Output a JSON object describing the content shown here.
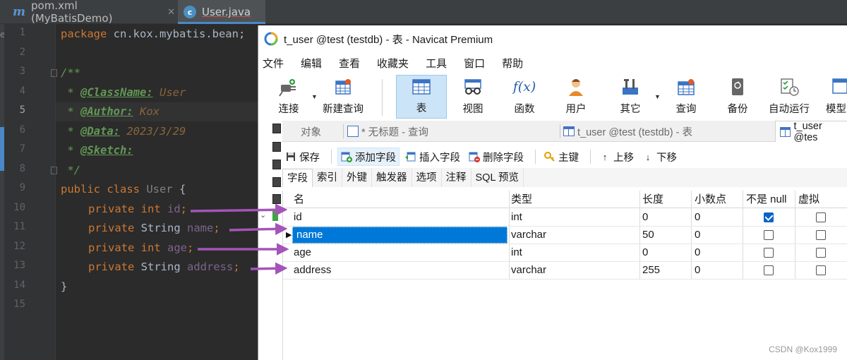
{
  "ide": {
    "tabs": [
      {
        "label": "pom.xml (MyBatisDemo)",
        "icon": "maven-m-icon"
      },
      {
        "label": "User.java",
        "icon": "java-class-icon"
      }
    ],
    "line_numbers": [
      "1",
      "2",
      "3",
      "4",
      "5",
      "6",
      "7",
      "8",
      "9",
      "10",
      "11",
      "12",
      "13",
      "14",
      "15"
    ],
    "current_line": "5",
    "code": {
      "l1_kw": "package",
      "l1_rest": " cn.kox.mybatis.bean;",
      "l3": "/**",
      "l4_pre": " * ",
      "l4_tag": "@ClassName:",
      "l4_val": " User",
      "l5_pre": " * ",
      "l5_tag": "@Author:",
      "l5_val": " Kox",
      "l6_pre": " * ",
      "l6_tag": "@Data:",
      "l6_val": " 2023/3/29",
      "l7_pre": " * ",
      "l7_tag": "@Sketch:",
      "l8": " */",
      "l9_kw": "public class",
      "l9_cls": " User",
      "l9_rest": " {",
      "l10_kw": "private int",
      "l10_fld": " id",
      "l10_end": ";",
      "l11_kw": "private",
      "l11_type": " String",
      "l11_fld": " name",
      "l11_end": ";",
      "l12_kw": "private int",
      "l12_fld": " age",
      "l12_end": ";",
      "l13_kw": "private",
      "l13_type": " String",
      "l13_fld": " address",
      "l13_end": ";",
      "l14": "}"
    }
  },
  "navicat": {
    "title": "t_user @test (testdb) - 表 - Navicat Premium",
    "menu": [
      "文件",
      "编辑",
      "查看",
      "收藏夹",
      "工具",
      "窗口",
      "帮助"
    ],
    "toolbar": [
      {
        "label": "连接",
        "icon": "plug-connection-icon"
      },
      {
        "label": "新建查询",
        "icon": "new-query-icon"
      },
      {
        "label": "表",
        "icon": "table-icon"
      },
      {
        "label": "视图",
        "icon": "view-glasses-icon"
      },
      {
        "label": "函数",
        "icon": "function-fx-icon"
      },
      {
        "label": "用户",
        "icon": "user-icon"
      },
      {
        "label": "其它",
        "icon": "tools-icon"
      },
      {
        "label": "查询",
        "icon": "query-grid-icon"
      },
      {
        "label": "备份",
        "icon": "backup-icon"
      },
      {
        "label": "自动运行",
        "icon": "auto-run-icon"
      },
      {
        "label": "模型",
        "icon": "model-icon"
      }
    ],
    "function_icon_text": "f(x)",
    "object_tabs": [
      {
        "label": "对象"
      },
      {
        "label": "* 无标题 - 查询"
      },
      {
        "label": "t_user @test (testdb) - 表"
      },
      {
        "label": "t_user @tes"
      }
    ],
    "actions": [
      {
        "label": "保存",
        "icon": "save-disk-icon"
      },
      {
        "label": "添加字段",
        "icon": "add-field-icon"
      },
      {
        "label": "插入字段",
        "icon": "insert-field-icon"
      },
      {
        "label": "删除字段",
        "icon": "delete-field-icon"
      },
      {
        "label": "主键",
        "icon": "primary-key-icon"
      },
      {
        "label": "上移",
        "icon": "arrow-up-icon"
      },
      {
        "label": "下移",
        "icon": "arrow-down-icon"
      }
    ],
    "subtabs": [
      "字段",
      "索引",
      "外键",
      "触发器",
      "选项",
      "注释",
      "SQL 预览"
    ],
    "grid": {
      "headers": [
        "名",
        "类型",
        "长度",
        "小数点",
        "不是 null",
        "虚拟"
      ],
      "rows": [
        {
          "name": "id",
          "type": "int",
          "length": "0",
          "decimals": "0",
          "not_null": true,
          "virtual": false
        },
        {
          "name": "name",
          "type": "varchar",
          "length": "50",
          "decimals": "0",
          "not_null": false,
          "virtual": false
        },
        {
          "name": "age",
          "type": "int",
          "length": "0",
          "decimals": "0",
          "not_null": false,
          "virtual": false
        },
        {
          "name": "address",
          "type": "varchar",
          "length": "255",
          "decimals": "0",
          "not_null": false,
          "virtual": false
        }
      ],
      "selected_row": "name"
    }
  },
  "watermark": "CSDN @Kox1999",
  "colors": {
    "ide_bg": "#2b2b2b",
    "keyword": "#cc7832",
    "comment": "#629755",
    "arrow": "#a455b8",
    "selection": "#0078d7",
    "toolbar_active": "#cce4f7"
  }
}
